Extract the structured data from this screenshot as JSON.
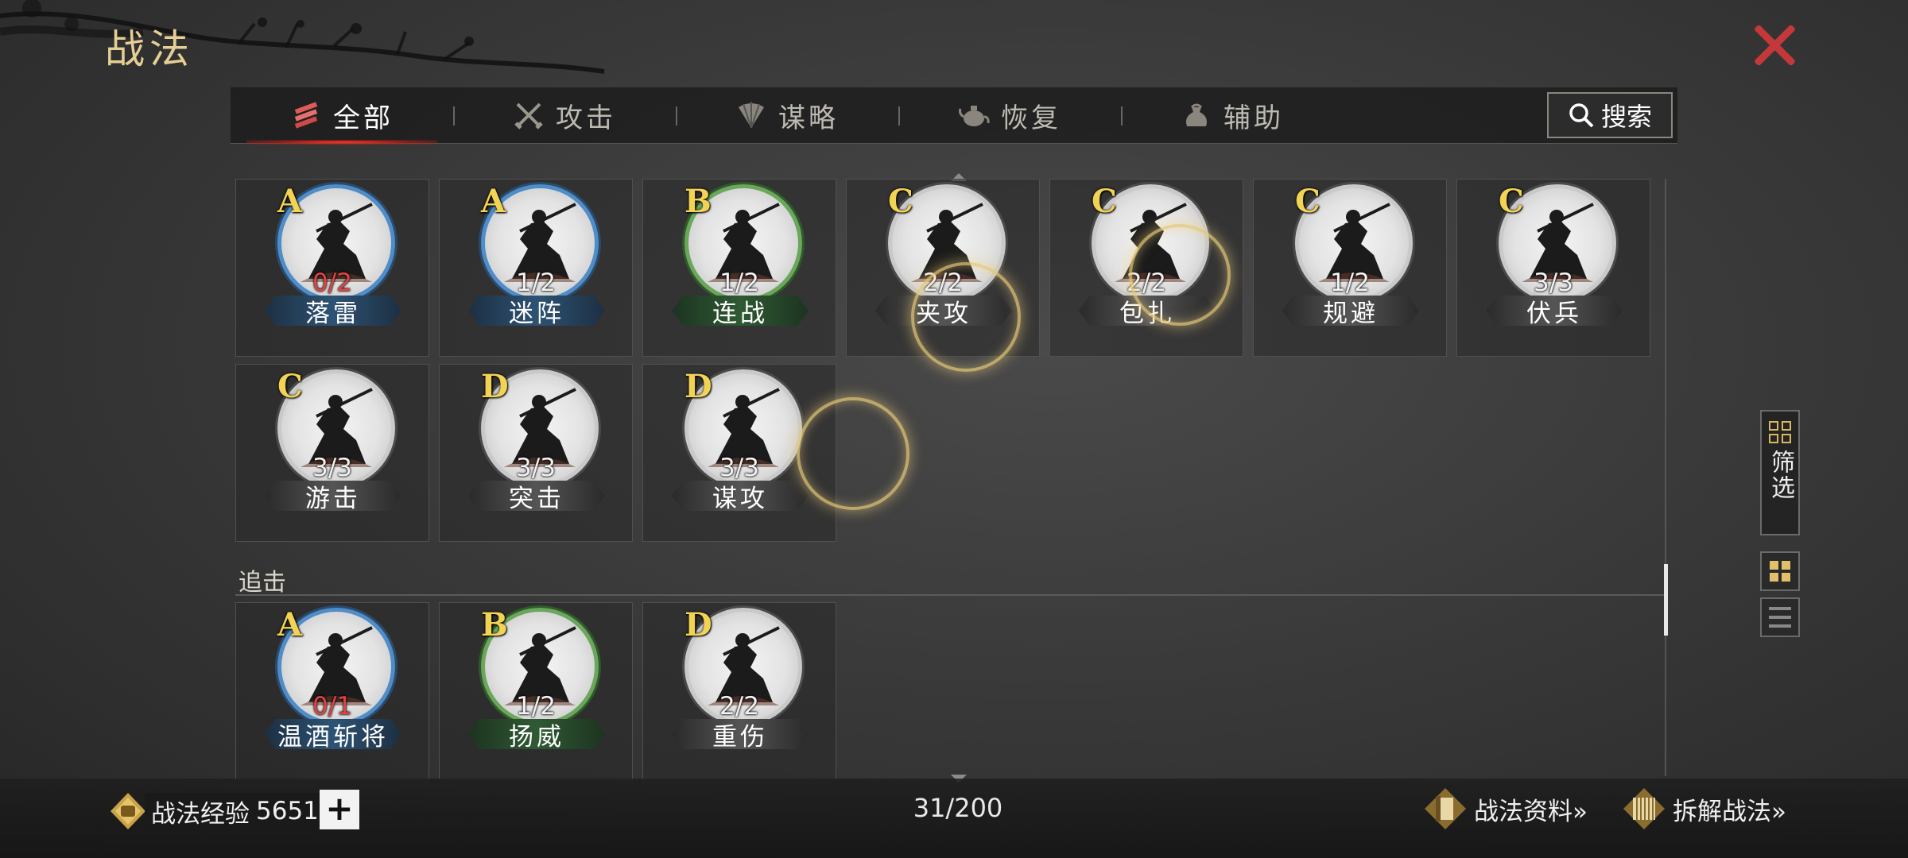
{
  "header": {
    "title": "战法"
  },
  "tabs": [
    {
      "label": "全部",
      "icon": "all-skills-icon",
      "active": true
    },
    {
      "label": "攻击",
      "icon": "crossed-swords-icon",
      "active": false
    },
    {
      "label": "谋略",
      "icon": "fan-icon",
      "active": false
    },
    {
      "label": "恢复",
      "icon": "teapot-icon",
      "active": false
    },
    {
      "label": "辅助",
      "icon": "bag-icon",
      "active": false
    }
  ],
  "search": {
    "label": "搜索"
  },
  "skills_row1": [
    {
      "grade": "A",
      "count": "0/2",
      "name": "落雷",
      "count_red": true,
      "tier": "blue"
    },
    {
      "grade": "A",
      "count": "1/2",
      "name": "迷阵",
      "count_red": false,
      "tier": "blue"
    },
    {
      "grade": "B",
      "count": "1/2",
      "name": "连战",
      "count_red": false,
      "tier": "green"
    },
    {
      "grade": "C",
      "count": "2/2",
      "name": "夹攻",
      "count_red": false,
      "tier": "gray"
    },
    {
      "grade": "C",
      "count": "2/2",
      "name": "包扎",
      "count_red": false,
      "tier": "gray"
    },
    {
      "grade": "C",
      "count": "1/2",
      "name": "规避",
      "count_red": false,
      "tier": "gray"
    },
    {
      "grade": "C",
      "count": "3/3",
      "name": "伏兵",
      "count_red": false,
      "tier": "gray"
    }
  ],
  "skills_row2": [
    {
      "grade": "C",
      "count": "3/3",
      "name": "游击",
      "count_red": false,
      "tier": "gray"
    },
    {
      "grade": "D",
      "count": "3/3",
      "name": "突击",
      "count_red": false,
      "tier": "gray"
    },
    {
      "grade": "D",
      "count": "3/3",
      "name": "谋攻",
      "count_red": false,
      "tier": "gray"
    }
  ],
  "section": {
    "label": "追击"
  },
  "skills_row3": [
    {
      "grade": "A",
      "count": "0/1",
      "name": "温酒斩将",
      "count_red": true,
      "tier": "blue"
    },
    {
      "grade": "B",
      "count": "1/2",
      "name": "扬威",
      "count_red": false,
      "tier": "green"
    },
    {
      "grade": "D",
      "count": "2/2",
      "name": "重伤",
      "count_red": false,
      "tier": "gray"
    }
  ],
  "side": {
    "filter_label": "筛选"
  },
  "footer": {
    "exp_label": "战法经验",
    "exp_value": "5651",
    "plus_label": "+",
    "counter": "31/200",
    "info_link": "战法资料»",
    "dismantle_link": "拆解战法»"
  },
  "colors": {
    "accent_gold": "#e6cf95",
    "close_red": "#c4383a",
    "grade_yellow": "#f3d354",
    "count_red": "#e24444"
  }
}
